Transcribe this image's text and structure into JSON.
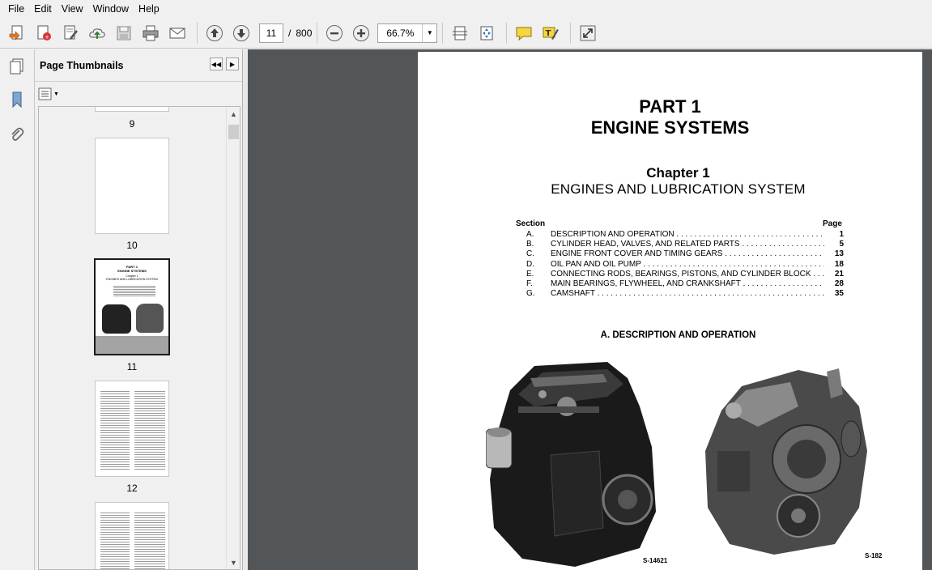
{
  "menu": [
    "File",
    "Edit",
    "View",
    "Window",
    "Help"
  ],
  "toolbar": {
    "page_current": "11",
    "page_sep": "/",
    "page_total": "800",
    "zoom": "66.7%"
  },
  "panel": {
    "title": "Page Thumbnails"
  },
  "thumbnails": [
    {
      "label": "9"
    },
    {
      "label": "10"
    },
    {
      "label": "11"
    },
    {
      "label": "12"
    }
  ],
  "thumb11": {
    "title1": "PART 1",
    "title2": "ENGINE SYSTEMS",
    "ch": "Chapter 1",
    "sub": "ENGINES AND LUBRICATION SYSTEM"
  },
  "document": {
    "part": "PART 1",
    "systems": "ENGINE SYSTEMS",
    "chapter": "Chapter 1",
    "chapter_title": "ENGINES AND LUBRICATION SYSTEM",
    "section_label": "Section",
    "page_label": "Page",
    "toc": [
      {
        "letter": "A.",
        "title": "DESCRIPTION AND OPERATION . . . . . . . . . . . . . . . . . . . . . . . . . . . . . . . . . . . . . . . . . . . . . . . . . . .",
        "page": "1"
      },
      {
        "letter": "B.",
        "title": "CYLINDER HEAD, VALVES, AND RELATED PARTS . . . . . . . . . . . . . . . . . . . . . . . . . . . . . . . . . . . . .",
        "page": "5"
      },
      {
        "letter": "C.",
        "title": "ENGINE FRONT COVER AND TIMING GEARS . . . . . . . . . . . . . . . . . . . . . . . . . . . . . . . . . . . . . . . . .",
        "page": "13"
      },
      {
        "letter": "D.",
        "title": "OIL PAN AND OIL PUMP . . . . . . . . . . . . . . . . . . . . . . . . . . . . . . . . . . . . . . . . . . . . . . . . . . . . . . . . .",
        "page": "18"
      },
      {
        "letter": "E.",
        "title": "CONNECTING RODS, BEARINGS, PISTONS, AND CYLINDER BLOCK . . . .",
        "page": "21"
      },
      {
        "letter": "F.",
        "title": "MAIN BEARINGS, FLYWHEEL, AND CRANKSHAFT . . . . . . . . . . . . . . . . . . . . . . . . . . . . . . . . . . . .",
        "page": "28"
      },
      {
        "letter": "G.",
        "title": "CAMSHAFT . . . . . . . . . . . . . . . . . . . . . . . . . . . . . . . . . . . . . . . . . . . . . . . . . . . . . . . . . . . . . . . . . . . .",
        "page": "35"
      }
    ],
    "section_a": "A.  DESCRIPTION AND OPERATION",
    "fig1_label": "S-14621",
    "fig2_label": "S-182"
  }
}
